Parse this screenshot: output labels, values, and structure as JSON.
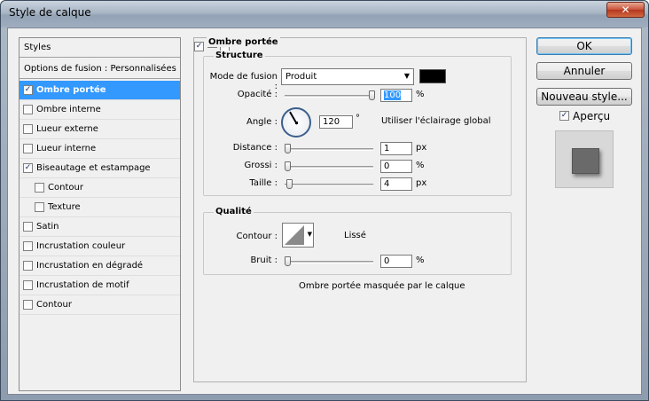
{
  "window": {
    "title": "Style de calque",
    "close_symbol": "✕"
  },
  "styles_panel": {
    "header": "Styles",
    "fusion_options": "Options de fusion : Personnalisées",
    "items": [
      {
        "label": "Ombre portée",
        "checked": true,
        "selected": true
      },
      {
        "label": "Ombre interne",
        "checked": false
      },
      {
        "label": "Lueur externe",
        "checked": false
      },
      {
        "label": "Lueur interne",
        "checked": false
      },
      {
        "label": "Biseautage et estampage",
        "checked": true
      },
      {
        "label": "Contour",
        "checked": false,
        "indent": true
      },
      {
        "label": "Texture",
        "checked": false,
        "indent": true
      },
      {
        "label": "Satin",
        "checked": false
      },
      {
        "label": "Incrustation couleur",
        "checked": false
      },
      {
        "label": "Incrustation en dégradé",
        "checked": false
      },
      {
        "label": "Incrustation de motif",
        "checked": false
      },
      {
        "label": "Contour",
        "checked": false
      }
    ]
  },
  "drop_shadow": {
    "section_title": "Ombre portée",
    "structure_title": "Structure",
    "blend_mode_label": "Mode de fusion :",
    "blend_mode_value": "Produit",
    "shadow_color": "#000000",
    "opacity_label": "Opacité :",
    "opacity_value": "100",
    "opacity_unit": "%",
    "opacity_level": 1.0,
    "angle_label": "Angle :",
    "angle_value": "120",
    "angle_unit": "°",
    "global_light_label": "Utiliser l'éclairage global",
    "global_light_checked": true,
    "distance_label": "Distance :",
    "distance_value": "1",
    "distance_unit": "px",
    "spread_label": "Grossi :",
    "spread_value": "0",
    "spread_unit": "%",
    "size_label": "Taille :",
    "size_value": "4",
    "size_unit": "px",
    "quality_title": "Qualité",
    "contour_label": "Contour :",
    "antialias_label": "Lissé",
    "antialias_checked": false,
    "noise_label": "Bruit :",
    "noise_value": "0",
    "noise_unit": "%",
    "knockout_label": "Ombre portée masquée par le calque",
    "knockout_checked": true
  },
  "buttons": {
    "ok": "OK",
    "cancel": "Annuler",
    "new_style": "Nouveau style...",
    "preview_label": "Aperçu",
    "preview_checked": true
  }
}
